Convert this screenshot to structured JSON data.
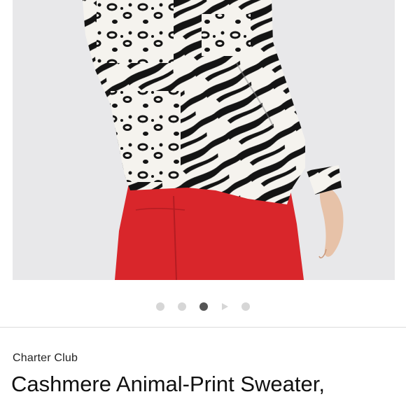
{
  "product": {
    "brand": "Charter Club",
    "title": "Cashmere Animal-Print Sweater,"
  },
  "gallery": {
    "image_icon": "product-photo",
    "dots": [
      "image-1",
      "image-2",
      "image-3",
      "video",
      "image-5"
    ],
    "active_index": 2
  },
  "colors": {
    "background": "#ffffff",
    "photo_backdrop": "#e8e8ea",
    "pants": "#d9262b",
    "print_dark": "#141414",
    "print_light": "#f5f3ee",
    "dot_active": "#555555",
    "dot_inactive": "#d6d6d6"
  }
}
